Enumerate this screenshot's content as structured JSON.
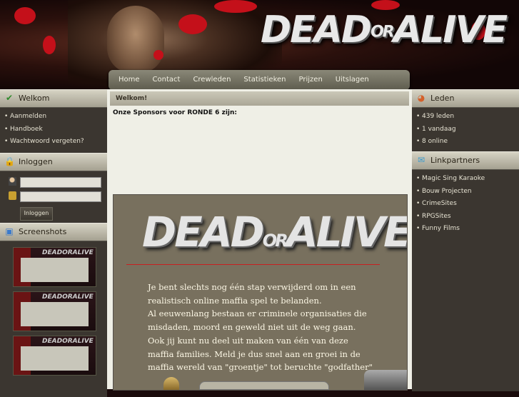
{
  "logo": {
    "left": "DEAD",
    "or": "OR",
    "right": "ALIVE"
  },
  "nav": [
    "Home",
    "Contact",
    "Crewleden",
    "Statistieken",
    "Prijzen",
    "Uitslagen"
  ],
  "left": {
    "welkom": {
      "title": "Welkom",
      "items": [
        "Aanmelden",
        "Handboek",
        "Wachtwoord vergeten?"
      ]
    },
    "inloggen": {
      "title": "Inloggen",
      "username_value": "",
      "password_value": "",
      "button": "Inloggen"
    },
    "screenshots": {
      "title": "Screenshots",
      "count": 3
    }
  },
  "right": {
    "leden": {
      "title": "Leden",
      "items": [
        "439 leden",
        "1 vandaag",
        "8 online"
      ]
    },
    "linkpartners": {
      "title": "Linkpartners",
      "items": [
        "Magic Sing Karaoke",
        "Bouw Projecten",
        "CrimeSites",
        "RPGSites",
        "Funny Films"
      ]
    }
  },
  "main": {
    "heading": "Welkom!",
    "sponsors": "Onze Sponsors voor RONDE 6 zijn:",
    "promo": {
      "logo_left": "DEAD",
      "logo_or": "OR",
      "logo_right": "ALIVE",
      "lines": [
        "Je bent slechts nog één stap verwijderd om in een",
        "realistisch online maffia spel te belanden.",
        "Al eeuwenlang bestaan er criminele organisaties die",
        "misdaden, moord en geweld niet uit de weg gaan.",
        "Ook jij kunt nu deel uit maken van één van deze",
        "maffia families. Meld je dus snel aan en groei in de",
        "maffia wereld van \"groentje\" tot beruchte \"godfather\""
      ]
    }
  },
  "colors": {
    "blood": "#c4101a",
    "panel": "#3b3630",
    "nav": "#6e6c5e"
  }
}
